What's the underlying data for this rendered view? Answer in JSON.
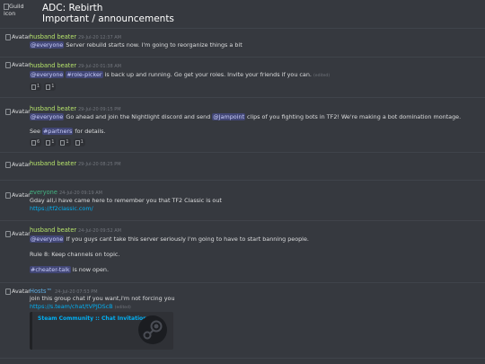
{
  "header": {
    "guild_icon_alt": "Guild icon",
    "guild_name": "ADC: Rebirth",
    "channel_name": "Important / announcements"
  },
  "avatar_alt": "Avatar",
  "messages": [
    {
      "author": "husband beater",
      "author_color": "#b5e26b",
      "timestamp": "29-Jul-20 12:37 AM",
      "lines": [
        {
          "mention": "@everyone",
          "text": " Server rebuild starts now. I'm going to reorganize things a bit"
        }
      ]
    },
    {
      "author": "husband beater",
      "author_color": "#b5e26b",
      "timestamp": "29-Jul-20 01:38 AM",
      "lines": [
        {
          "mention": "@everyone",
          "mention2": "#role-picker",
          "text": " is back up and running. Go get your roles. Invite your friends if you can.",
          "edited": "(edited)"
        }
      ],
      "reactions": [
        {
          "count": "1"
        },
        {
          "count": "1"
        }
      ]
    },
    {
      "author": "husband beater",
      "author_color": "#b5e26b",
      "timestamp": "29-Jul-20 09:15 PM",
      "lines": [
        {
          "mention": "@everyone",
          "text1": " Go ahead and join the Nightlight discord and send ",
          "mention2": "@Jampoint",
          "text2": " clips of you fighting bots in TF2! We're making a bot domination montage."
        },
        {
          "pre": "See ",
          "mention": "#partners",
          "text": " for details."
        }
      ],
      "reactions": [
        {
          "count": "6"
        },
        {
          "count": "1"
        },
        {
          "count": "1"
        },
        {
          "count": "1"
        }
      ]
    },
    {
      "author": "husband beater",
      "author_color": "#b5e26b",
      "timestamp": "29-Jul-20 08:25 PM",
      "lines": []
    },
    {
      "author": "everyone",
      "author_color": "#43b581",
      "timestamp": "24-Jul-20 09:19 AM",
      "lines": [
        {
          "text": "Gday all,i have came here to remember you that TF2 Classic is out"
        },
        {
          "link": "https://tf2classic.com/"
        }
      ]
    },
    {
      "author": "husband beater",
      "author_color": "#b5e26b",
      "timestamp": "24-Jul-20 09:52 AM",
      "lines": [
        {
          "mention": "@everyone",
          "text": " If you guys cant take this server seriously I'm going to have to start banning people."
        },
        {
          "text": "Rule 8: Keep channels on topic."
        },
        {
          "mention": "#cheater-talk",
          "text": " is now open."
        }
      ]
    },
    {
      "author": "Hosts™",
      "author_color": "#5dade2",
      "timestamp": "24-Jul-20 07:53 PM",
      "lines": [
        {
          "text": "join this group chat if you want,i'm not forcing you"
        },
        {
          "link": "https://s.team/chat/tVPJDScB",
          "edited": "(edited)"
        }
      ],
      "embed": {
        "title": "Steam Community :: Chat Invitation"
      }
    }
  ],
  "colors": {
    "background": "#36393f",
    "mention_bg": "#414675",
    "link": "#00b0f4",
    "role_green": "#b5e26b",
    "role_teal": "#43b581",
    "role_blue": "#5dade2"
  },
  "icons": [
    "guild-icon",
    "avatar-icon",
    "reaction-emoji-icon",
    "steam-logo-icon"
  ]
}
